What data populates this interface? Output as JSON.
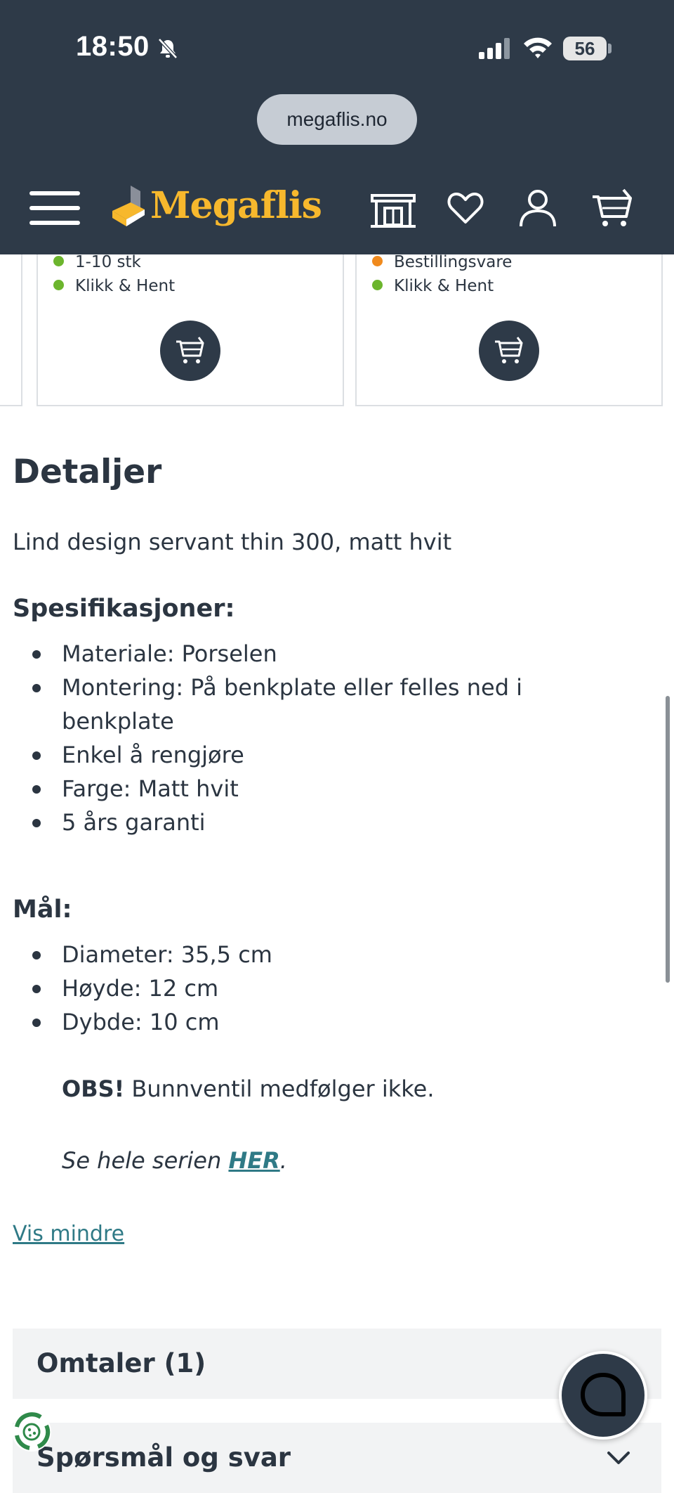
{
  "status_bar": {
    "time": "18:50",
    "battery": "56"
  },
  "browser": {
    "url": "megaflis.no"
  },
  "header": {
    "logo_text": "Megaflis",
    "brand_color": "#f7b82d",
    "bar_color": "#2e3a48"
  },
  "product_cards": [
    {
      "stock_label": "1-10 stk",
      "stock_status": "green",
      "pickup_label": "Klikk & Hent"
    },
    {
      "stock_label": "Bestillingsvare",
      "stock_status": "orange",
      "pickup_label": "Klikk & Hent"
    }
  ],
  "details": {
    "heading": "Detaljer",
    "description": "Lind design servant thin 300, matt hvit",
    "spec_heading": "Spesifikasjoner:",
    "specs": [
      "Materiale: Porselen",
      "Montering: På benkplate eller felles ned i benkplate",
      "Enkel å rengjøre",
      "Farge: Matt hvit",
      "5 års garanti"
    ],
    "dim_heading": "Mål:",
    "dimensions": [
      "Diameter: 35,5 cm",
      "Høyde: 12 cm",
      "Dybde: 10 cm"
    ],
    "obs_label": "OBS!",
    "obs_text": " Bunnventil medfølger ikke.",
    "series_prefix": "Se hele serien ",
    "series_link": "HER",
    "series_suffix": ".",
    "toggle_label": "Vis mindre"
  },
  "accordions": [
    {
      "label": "Omtaler (1)"
    },
    {
      "label": "Spørsmål og svar"
    }
  ]
}
